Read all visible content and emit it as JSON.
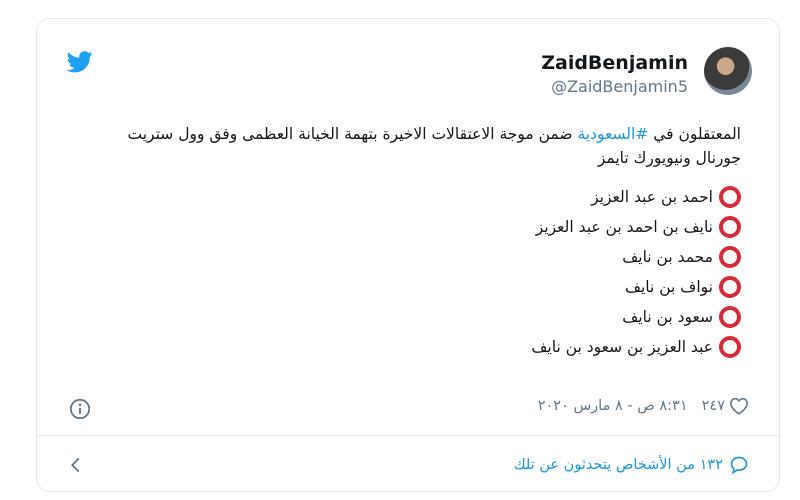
{
  "author": {
    "display_name": "ZaidBenjamin",
    "handle": "@ZaidBenjamin5"
  },
  "tweet": {
    "text_before": "المعتقلون في ",
    "hashtag": "#السعودية",
    "text_after": " ضمن موجة الاعتقالات الاخيرة بتهمة الخيانة العظمى وفق وول ستريت جورنال ونيويورك تايمز",
    "names": [
      "احمد بن عبد العزيز",
      "نايف بن احمد بن عبد العزيز",
      "محمد بن نايف",
      "نواف بن نايف",
      "سعود بن نايف",
      "عبد العزيز بن سعود بن نايف"
    ]
  },
  "meta": {
    "likes": "٢٤٧",
    "timestamp": "٨:٣١ ص - ٨ مارس ٢٠٢٠"
  },
  "conversation": {
    "label": "١٣٢ من الأشخاص يتحدثون عن تلك"
  },
  "colors": {
    "link": "#1b95e0",
    "ring": "#d52b3a",
    "muted": "#657786",
    "twitter_blue": "#1da1f2"
  },
  "icons": [
    "twitter-bird-icon",
    "info-icon",
    "heart-icon",
    "speech-bubble-icon",
    "chevron-left-icon",
    "red-circle-emoji"
  ]
}
